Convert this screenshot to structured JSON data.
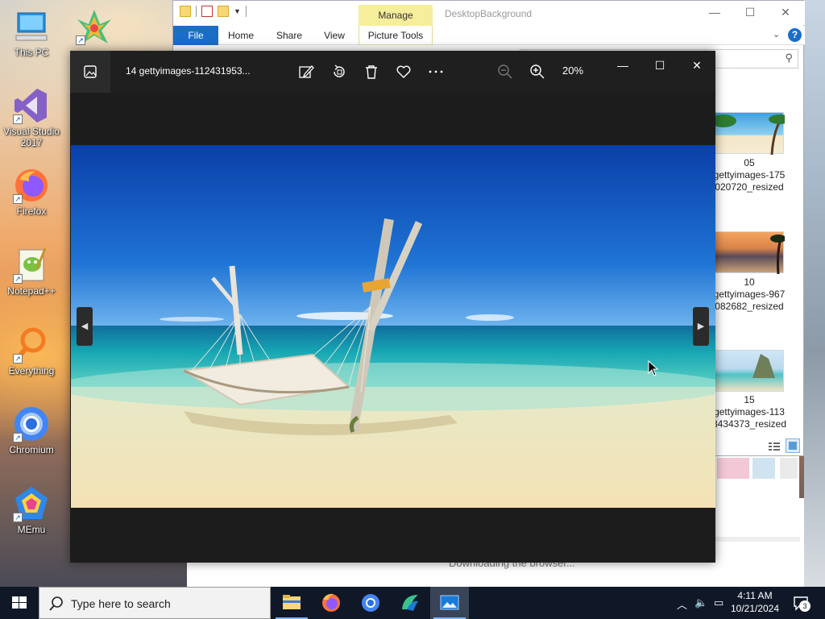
{
  "desktop": {
    "icons": [
      {
        "label": "This PC"
      },
      {
        "label": "Multi-IE"
      },
      {
        "label": "Visual Studio 2017"
      },
      {
        "label": "Firefox"
      },
      {
        "label": "Notepad++"
      },
      {
        "label": "Everything"
      },
      {
        "label": "Chromium"
      },
      {
        "label": "MEmu"
      }
    ]
  },
  "explorer": {
    "title": "DesktopBackground",
    "manage_tab": "Manage",
    "ribbon_tabs": [
      "File",
      "Home",
      "Share",
      "View",
      "Picture Tools"
    ],
    "help": "?",
    "files": [
      {
        "line1": "05",
        "line2": "gettyimages-175",
        "line3": "020720_resized"
      },
      {
        "line1": "10",
        "line2": "gettyimages-967",
        "line3": "082682_resized"
      },
      {
        "line1": "15",
        "line2": "gettyimages-113",
        "line3": "8434373_resized"
      }
    ],
    "status_text": "Downloading the browser..."
  },
  "photos": {
    "title": "14 gettyimages-112431953...",
    "zoom": "20%",
    "toolbar": [
      "gallery-icon",
      "edit-icon",
      "rotate-icon",
      "delete-icon",
      "favorite-icon",
      "more-icon",
      "zoom-out-icon",
      "zoom-in-icon"
    ]
  },
  "taskbar": {
    "search_placeholder": "Type here to search",
    "apps": [
      "file-explorer",
      "firefox",
      "chromium",
      "multi-ie",
      "photos"
    ],
    "time": "4:11 AM",
    "date": "10/21/2024",
    "notifications": "3"
  },
  "colors": {
    "accent": "#1a6ec7",
    "taskbar": "#101828",
    "photos_bg": "#1c1c1c",
    "manage_tab": "#f6ee9a"
  }
}
